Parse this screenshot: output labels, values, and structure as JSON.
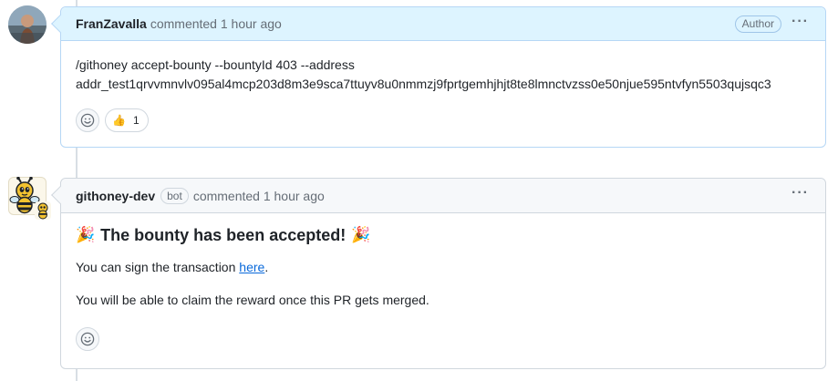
{
  "comments": [
    {
      "author": "FranZavalla",
      "timestamp": "commented 1 hour ago",
      "role_badge": "Author",
      "menu_glyph": "···",
      "body": {
        "line1": "/githoney accept-bounty --bountyId 403 --address",
        "line2": "addr_test1qrvvmnvlv095al4mcp203d8m3e9sca7ttuyv8u0nmmzj9fprtgemhjhjt8te8lmnctvzss0e50njue595ntvfyn5503qujsqc3"
      },
      "reactions": [
        {
          "icon": "thumbs-up-icon",
          "emoji": "👍",
          "count": "1"
        }
      ]
    },
    {
      "author": "githoney-dev",
      "bot_badge": "bot",
      "timestamp": "commented 1 hour ago",
      "menu_glyph": "···",
      "body": {
        "heading_emoji": "🎉",
        "heading": "The bounty has been accepted!",
        "sign_prefix": "You can sign the transaction ",
        "sign_link": "here",
        "sign_suffix": ".",
        "claim_text": "You will be able to claim the reward once this PR gets merged."
      }
    }
  ],
  "colors": {
    "author_header_bg": "#ddf4ff",
    "header_bg": "#f6f8fa",
    "link": "#0969da",
    "muted": "#656d76",
    "border": "#d0d7de"
  }
}
